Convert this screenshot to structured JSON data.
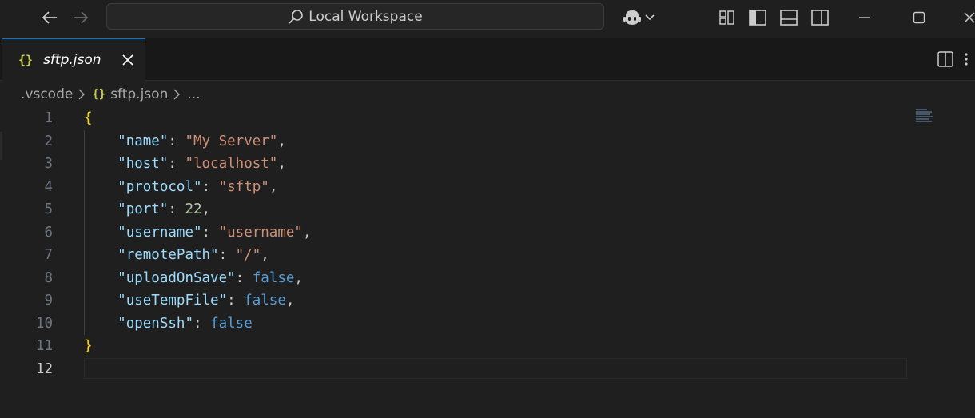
{
  "titlebar": {
    "search_text": "Local Workspace",
    "icons": [
      "arrow-left-icon",
      "arrow-right-icon",
      "search-icon",
      "copilot-icon",
      "chevron-down-icon",
      "customize-layout-icon",
      "toggle-primary-sidebar-icon",
      "toggle-panel-icon",
      "toggle-secondary-sidebar-icon",
      "minimize-icon",
      "maximize-icon",
      "close-icon"
    ]
  },
  "tab": {
    "icon_glyph": "{}",
    "label": "sftp.json"
  },
  "breadcrumb": {
    "folder": ".vscode",
    "icon_glyph": "{}",
    "file": "sftp.json",
    "more": "..."
  },
  "editor": {
    "line_numbers": [
      "1",
      "2",
      "3",
      "4",
      "5",
      "6",
      "7",
      "8",
      "9",
      "10",
      "11",
      "12"
    ],
    "active_line": 12,
    "lines": [
      {
        "open": "{"
      },
      {
        "key": "\"name\"",
        "value": "\"My Server\"",
        "trail": ","
      },
      {
        "key": "\"host\"",
        "value": "\"localhost\"",
        "trail": ","
      },
      {
        "key": "\"protocol\"",
        "value": "\"sftp\"",
        "trail": ","
      },
      {
        "key": "\"port\"",
        "value": "22",
        "trail": ","
      },
      {
        "key": "\"username\"",
        "value": "\"username\"",
        "trail": ","
      },
      {
        "key": "\"remotePath\"",
        "value": "\"/\"",
        "trail": ","
      },
      {
        "key": "\"uploadOnSave\"",
        "value": "false",
        "trail": ","
      },
      {
        "key": "\"useTempFile\"",
        "value": "false",
        "trail": ","
      },
      {
        "key": "\"openSsh\"",
        "value": "false",
        "trail": ""
      },
      {
        "close": "}"
      }
    ]
  },
  "colors": {
    "accent": "#0078d4",
    "key": "#9cdcfe",
    "string": "#ce9178",
    "number": "#b5cea8",
    "boolean": "#569cd6",
    "bracket": "#ffd700",
    "json_icon": "#cbcb41"
  }
}
